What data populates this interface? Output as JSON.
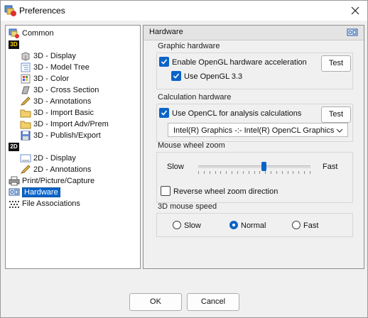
{
  "window": {
    "title": "Preferences"
  },
  "tree": {
    "items": [
      {
        "label": "Common",
        "icon": "common-icon"
      },
      {
        "label": "3D",
        "icon": "3d-category-icon"
      },
      {
        "label": "3D - Display",
        "icon": "cube-icon"
      },
      {
        "label": "3D - Model Tree",
        "icon": "tree-list-icon"
      },
      {
        "label": "3D - Color",
        "icon": "color-grid-icon"
      },
      {
        "label": "3D - Cross Section",
        "icon": "cross-section-icon"
      },
      {
        "label": "3D - Annotations",
        "icon": "pencil-icon"
      },
      {
        "label": "3D - Import Basic",
        "icon": "folder-icon"
      },
      {
        "label": "3D - Import Adv/Prem",
        "icon": "folder-icon"
      },
      {
        "label": "3D - Publish/Export",
        "icon": "floppy-icon"
      },
      {
        "label": "2D",
        "icon": "2d-category-icon"
      },
      {
        "label": "2D - Display",
        "icon": "drawing-icon"
      },
      {
        "label": "2D - Annotations",
        "icon": "pencil-icon"
      },
      {
        "label": "Print/Picture/Capture",
        "icon": "printer-icon"
      },
      {
        "label": "Hardware",
        "icon": "hardware-icon",
        "selected": true
      },
      {
        "label": "File Associations",
        "icon": "file-assoc-icon"
      }
    ]
  },
  "panel": {
    "title": "Hardware",
    "graphic": {
      "title": "Graphic hardware",
      "enable_opengl": {
        "label": "Enable OpenGL hardware acceleration",
        "checked": true
      },
      "use_opengl33": {
        "label": "Use OpenGL 3.3",
        "checked": true
      },
      "test_label": "Test"
    },
    "calculation": {
      "title": "Calculation hardware",
      "use_opencl": {
        "label": "Use OpenCL for analysis calculations",
        "checked": true
      },
      "test_label": "Test",
      "device": "Intel(R) Graphics -:- Intel(R) OpenCL Graphics"
    },
    "wheel": {
      "title": "Mouse wheel zoom",
      "slow_label": "Slow",
      "fast_label": "Fast",
      "level": 0.58,
      "reverse": {
        "label": "Reverse wheel zoom direction",
        "checked": false
      }
    },
    "mouse3d": {
      "title": "3D mouse speed",
      "options": [
        "Slow",
        "Normal",
        "Fast"
      ],
      "selected": "Normal"
    }
  },
  "footer": {
    "ok_label": "OK",
    "cancel_label": "Cancel"
  },
  "colors": {
    "accent": "#0a64c8"
  }
}
